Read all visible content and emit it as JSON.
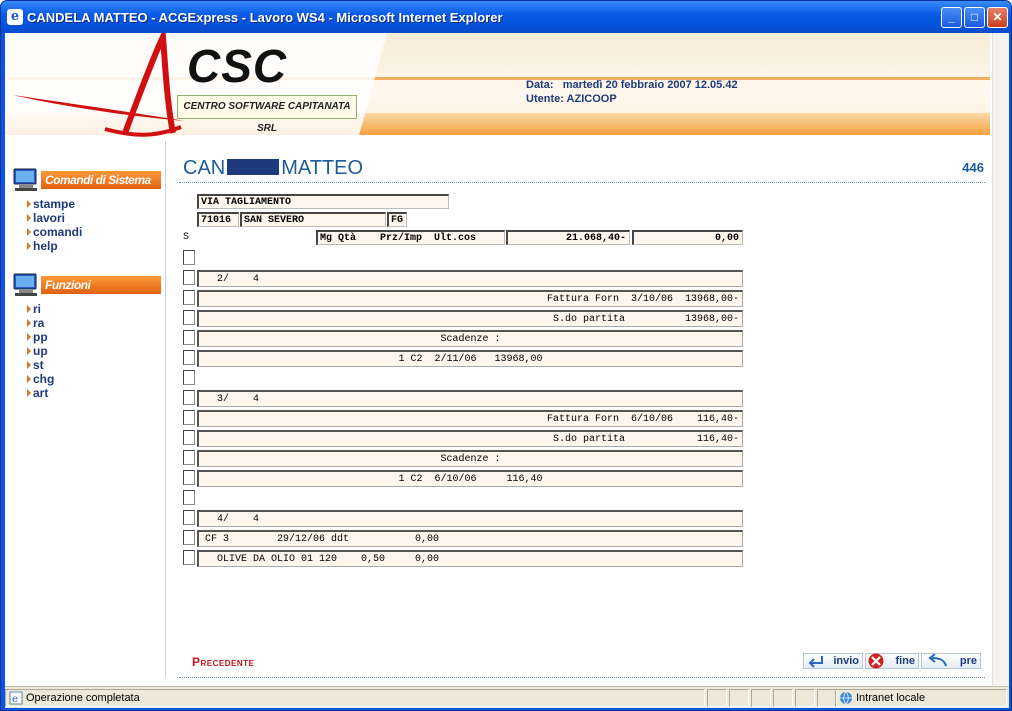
{
  "window": {
    "title": "CANDELA MATTEO - ACGExpress - Lavoro WS4 - Microsoft Internet Explorer",
    "minimize": "_",
    "maximize": "□",
    "close": "✕"
  },
  "header": {
    "logo_text": "CSC",
    "logo_subtitle": "CENTRO SOFTWARE CAPITANATA SRL",
    "data_label": "Data:",
    "data_value": "martedì 20 febbraio 2007 12.05.42",
    "utente_label": "Utente:",
    "utente_value": "AZICOOP"
  },
  "sidebar": {
    "section1_title": "Comandi di Sistema",
    "section1_items": [
      "stampe",
      "lavori",
      "comandi",
      "help"
    ],
    "section2_title": "Funzioni",
    "section2_items": [
      "ri",
      "ra",
      "pp",
      "up",
      "st",
      "chg",
      "art"
    ]
  },
  "page": {
    "title_left": "CAN",
    "title_right": "MATTEO",
    "page_number": "446",
    "address": "VIA TAGLIAMENTO",
    "cap": "71016",
    "city": "SAN SEVERO",
    "province": "FG",
    "s_label": "S",
    "cols_header": "Mg Qtà    Prz/Imp  Ult.cos",
    "total1": "21.068,40-",
    "total2": "0,00",
    "rows": [
      {
        "type": "blank"
      },
      {
        "type": "row",
        "text": "  2/    4",
        "align": "left"
      },
      {
        "type": "row",
        "text": "Fattura Forn  3/10/06  13968,00-",
        "align": "right"
      },
      {
        "type": "row",
        "text": "S.do partita          13968,00-",
        "align": "right"
      },
      {
        "type": "row",
        "text": "Scadenze :",
        "align": "center"
      },
      {
        "type": "row",
        "text": "1 C2  2/11/06   13968,00",
        "align": "center"
      },
      {
        "type": "blank"
      },
      {
        "type": "row",
        "text": "  3/    4",
        "align": "left"
      },
      {
        "type": "row",
        "text": "Fattura Forn  6/10/06    116,40-",
        "align": "right"
      },
      {
        "type": "row",
        "text": "S.do partita            116,40-",
        "align": "right"
      },
      {
        "type": "row",
        "text": "Scadenze :",
        "align": "center"
      },
      {
        "type": "row",
        "text": "1 C2  6/10/06     116,40",
        "align": "center"
      },
      {
        "type": "blank"
      },
      {
        "type": "row",
        "text": "  4/    4",
        "align": "left"
      },
      {
        "type": "row",
        "text": "CF 3        29/12/06 ddt           0,00",
        "align": "left"
      },
      {
        "type": "row",
        "text": "  OLIVE DA OLIO 01 120    0,50     0,00",
        "align": "left"
      }
    ]
  },
  "footer": {
    "precedente": "Precedente",
    "invio": "invio",
    "fine": "fine",
    "pre": "pre"
  },
  "status": {
    "text": "Operazione completata",
    "zone": "Intranet locale"
  }
}
